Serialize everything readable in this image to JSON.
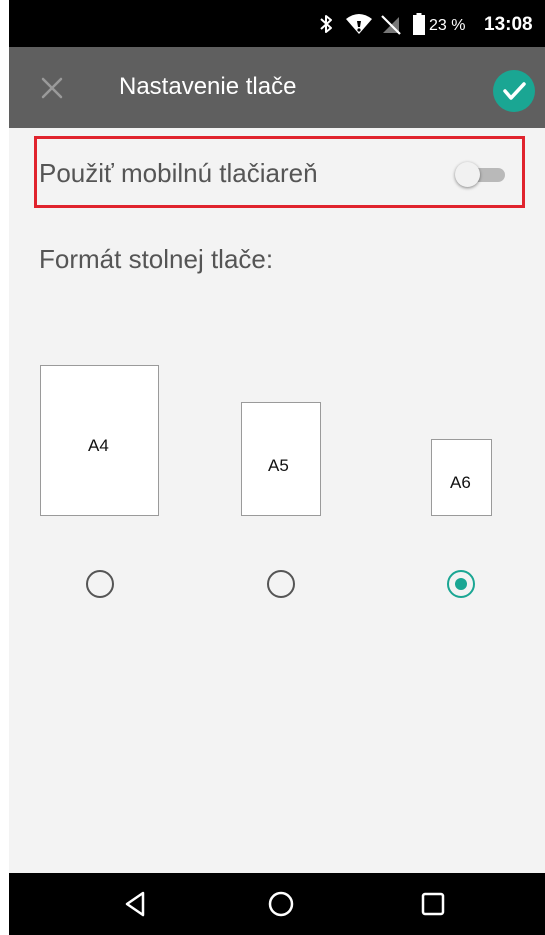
{
  "status_bar": {
    "icons": [
      "bluetooth-icon",
      "wifi-icon",
      "no-sim-icon",
      "battery-icon"
    ],
    "battery_text": "23 %",
    "time": "13:08"
  },
  "app_bar": {
    "title": "Nastavenie tlače",
    "close_icon": "close-icon",
    "confirm_icon": "check-icon",
    "accent_color": "#1aa693",
    "background_color": "#5f5f5f"
  },
  "settings": {
    "mobile_printer_label": "Použiť mobilnú tlačiareň",
    "mobile_printer_enabled": false,
    "highlight_color": "#e0232d"
  },
  "format": {
    "label": "Formát stolnej tlače:",
    "options": [
      {
        "label": "A4",
        "selected": false
      },
      {
        "label": "A5",
        "selected": false
      },
      {
        "label": "A6",
        "selected": true
      }
    ]
  },
  "nav_bar": {
    "buttons": [
      "back-icon",
      "home-icon",
      "recents-icon"
    ]
  }
}
